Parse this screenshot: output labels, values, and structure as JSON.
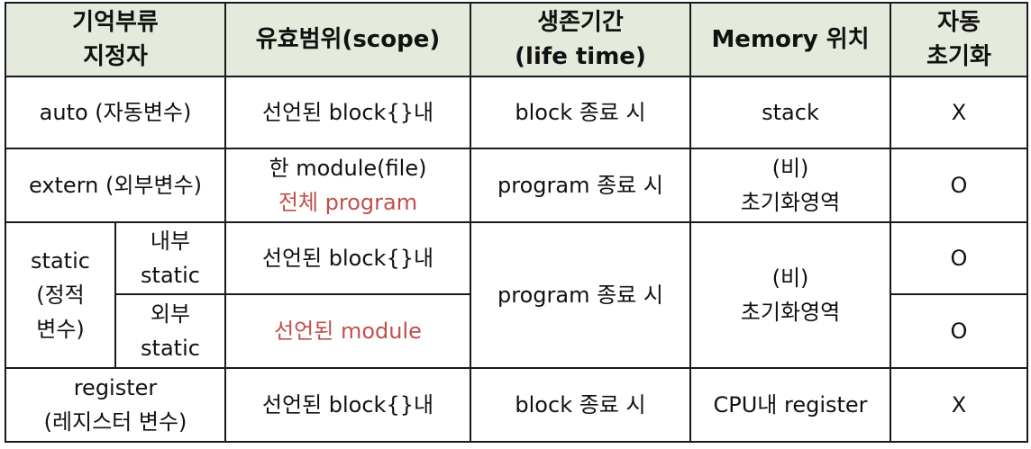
{
  "header": {
    "col1_line1": "기억부류",
    "col1_line2": "지정자",
    "col2": "유효범위(scope)",
    "col3_line1": "생존기간",
    "col3_line2": "(life  time)",
    "col4": "Memory  위치",
    "col5_line1": "자동",
    "col5_line2": "초기화"
  },
  "rows": {
    "auto": {
      "specifier": "auto  (자동변수)",
      "scope": "선언된  block{}내",
      "lifetime": "block  종료  시",
      "memory": "stack",
      "init": "X"
    },
    "extern": {
      "specifier": "extern  (외부변수)",
      "scope_line1": "한  module(file)",
      "scope_line2": "전체  program",
      "lifetime": "program  종료  시",
      "memory_line1": "(비)",
      "memory_line2": "초기화영역",
      "init": "O"
    },
    "static": {
      "group_line1": "static",
      "group_line2": "(정적",
      "group_line3": "변수)",
      "internal_line1": "내부",
      "internal_line2": "static",
      "internal_scope": "선언된  block{}내",
      "internal_init": "O",
      "external_line1": "외부",
      "external_line2": "static",
      "external_scope": "선언된  module",
      "external_init": "O",
      "lifetime": "program  종료  시",
      "memory_line1": "(비)",
      "memory_line2": "초기화영역"
    },
    "register": {
      "specifier_line1": "register",
      "specifier_line2": "(레지스터  변수)",
      "scope": "선언된  block{}내",
      "lifetime": "block  종료  시",
      "memory": "CPU내  register",
      "init": "X"
    }
  },
  "colors": {
    "header_bg": "#e4ebdc",
    "accent_text": "#c0504d",
    "border": "#1a1a1a"
  }
}
